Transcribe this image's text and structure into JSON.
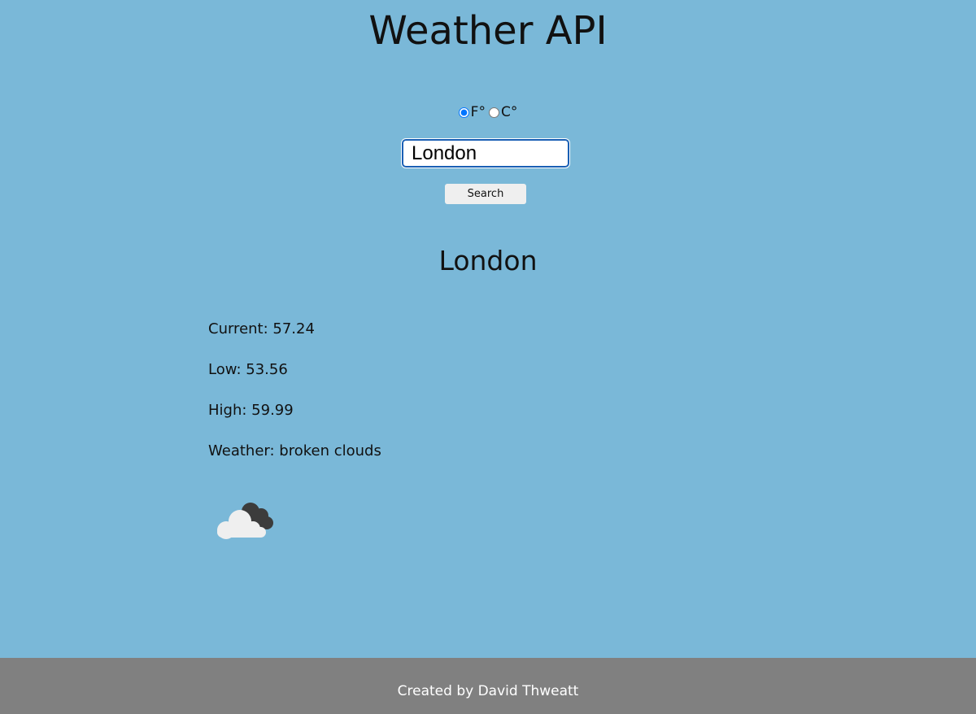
{
  "header": {
    "title": "Weather API"
  },
  "units": {
    "fahrenheit_label": "F°",
    "celsius_label": "C°",
    "selected": "fahrenheit"
  },
  "search": {
    "value": "London",
    "button_label": "Search"
  },
  "result": {
    "city": "London",
    "current_label": "Current:",
    "current_value": "57.24",
    "low_label": "Low:",
    "low_value": "53.56",
    "high_label": "High:",
    "high_value": "59.99",
    "weather_label": "Weather:",
    "weather_value": "broken clouds",
    "icon": "broken-clouds-icon"
  },
  "footer": {
    "credit": "Created by David Thweatt"
  },
  "colors": {
    "background": "#7ab8d8",
    "footer_background": "#808080",
    "input_border": "#1a5fb4"
  }
}
